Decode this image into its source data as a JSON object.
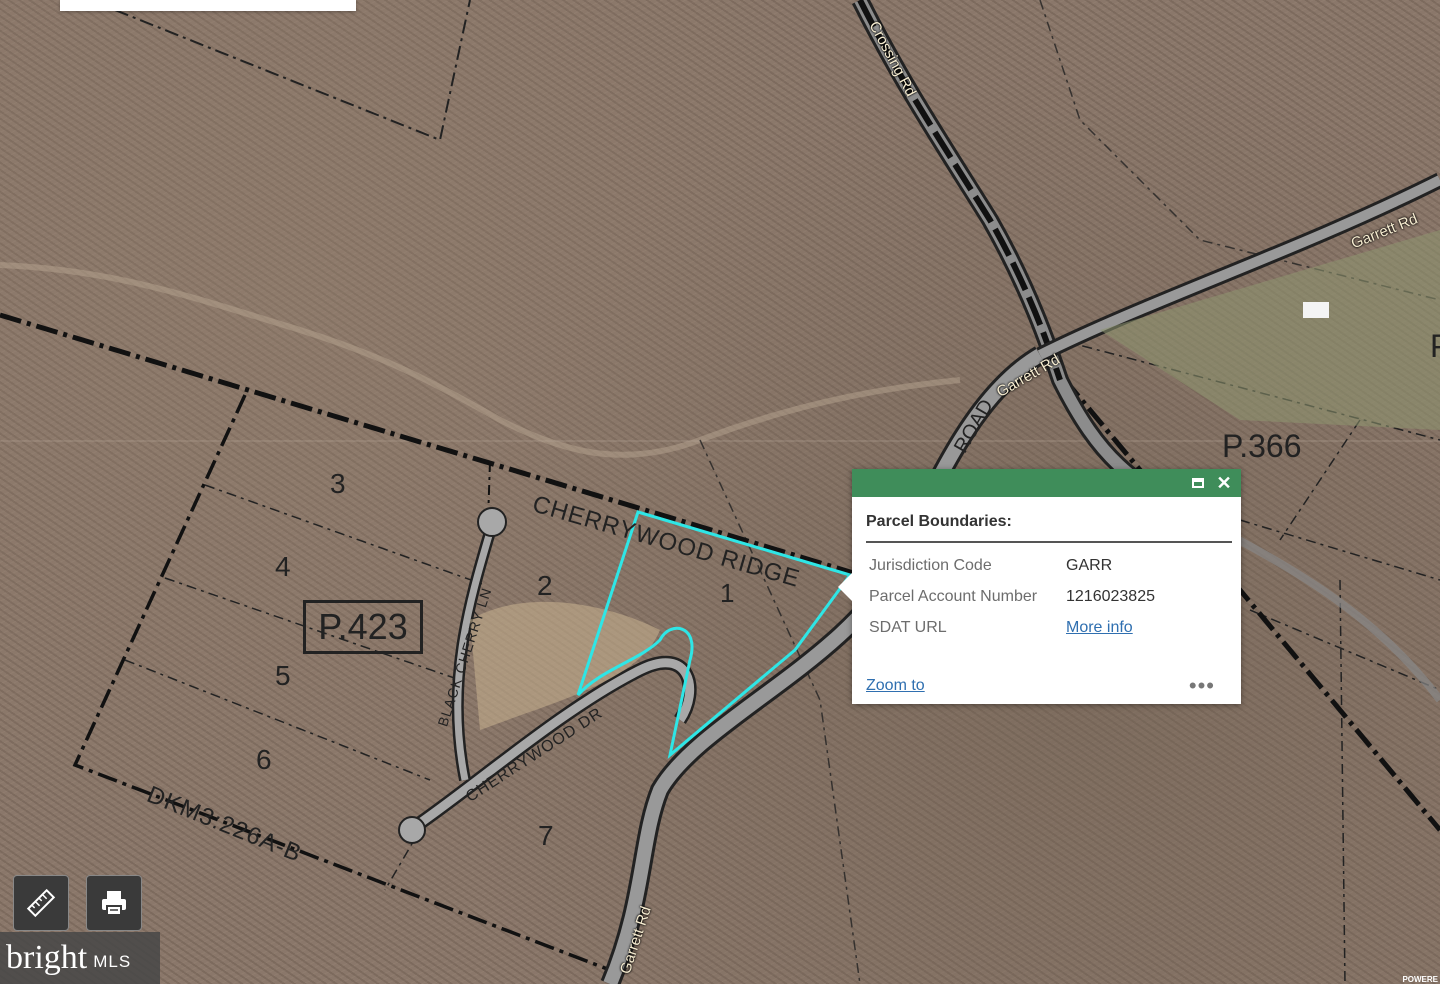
{
  "map": {
    "roads": {
      "crossing_rd": "Crossing Rd",
      "garrett_rd_upper": "Garrett Rd",
      "garrett_rd_mid": "Garrett Rd",
      "garrett_rd_lower": "Garrett Rd",
      "road_fragment": "ROAD",
      "cherrywood_dr": "CHERRYWOOD DR",
      "black_cherry_ln": "BLACK CHERRY LN"
    },
    "subdivision_label": "CHERRYWOOD RIDGE",
    "plat_reference": "DKM3:226A-B",
    "parcel_labels": {
      "main": "P.423",
      "east": "P.366",
      "edge": "P"
    },
    "lot_numbers": [
      "1",
      "2",
      "3",
      "4",
      "5",
      "6",
      "7"
    ],
    "selection_color": "#2ee6e6",
    "attribution": "POWERE"
  },
  "popup": {
    "header_color": "#3f8d5a",
    "maximize_icon": "maximize-icon",
    "close_icon": "close-icon",
    "close_glyph": "✕",
    "title": "Parcel Boundaries:",
    "attributes": [
      {
        "label": "Jurisdiction Code",
        "value": "GARR"
      },
      {
        "label": "Parcel Account Number",
        "value": "1216023825"
      },
      {
        "label": "SDAT URL",
        "value": "More info"
      }
    ],
    "zoom_to": "Zoom to",
    "more": "•••"
  },
  "tools": {
    "measure_icon": "ruler-icon",
    "print_icon": "printer-icon"
  },
  "branding": {
    "bright": "bright",
    "mls": "MLS"
  }
}
